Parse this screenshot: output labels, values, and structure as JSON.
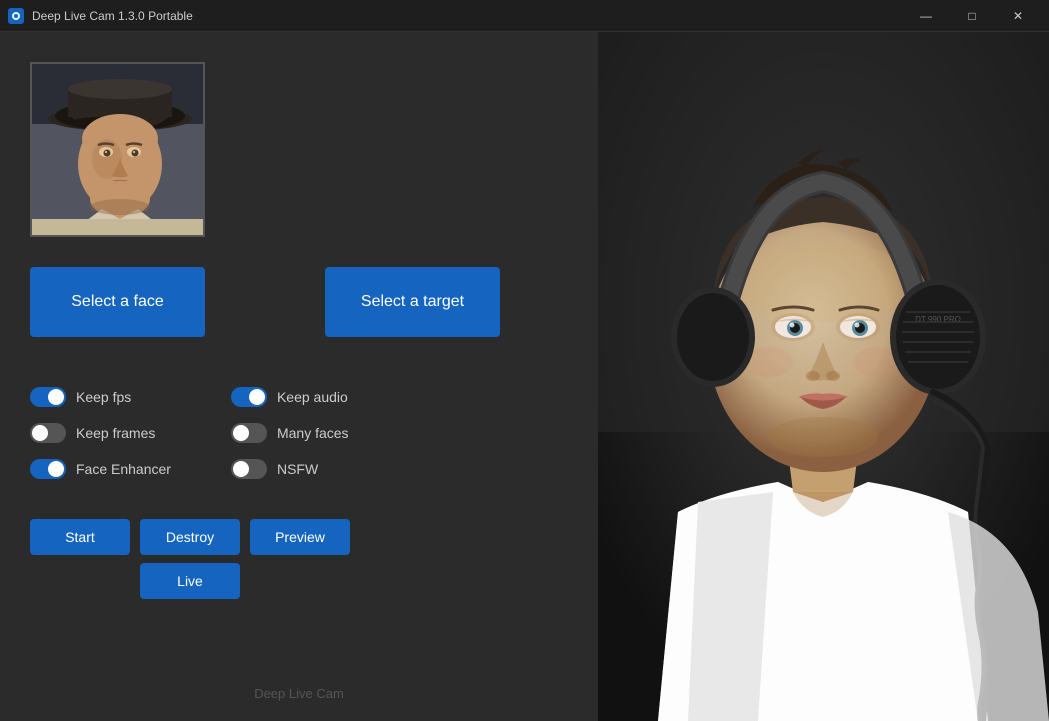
{
  "window": {
    "title": "Deep Live Cam 1.3.0 Portable",
    "controls": {
      "minimize": "—",
      "maximize": "□",
      "close": "✕"
    }
  },
  "left_panel": {
    "select_face_btn": "Select a face",
    "select_target_btn": "Select a target",
    "toggles_left": [
      {
        "id": "keep_fps",
        "label": "Keep fps",
        "state": "on"
      },
      {
        "id": "keep_frames",
        "label": "Keep frames",
        "state": "off"
      },
      {
        "id": "face_enhancer",
        "label": "Face Enhancer",
        "state": "on"
      }
    ],
    "toggles_right": [
      {
        "id": "keep_audio",
        "label": "Keep audio",
        "state": "on"
      },
      {
        "id": "many_faces",
        "label": "Many faces",
        "state": "off"
      },
      {
        "id": "nsfw",
        "label": "NSFW",
        "state": "off"
      }
    ],
    "action_buttons": {
      "start": "Start",
      "destroy": "Destroy",
      "preview": "Preview",
      "live": "Live"
    },
    "watermark": "Deep Live Cam"
  }
}
